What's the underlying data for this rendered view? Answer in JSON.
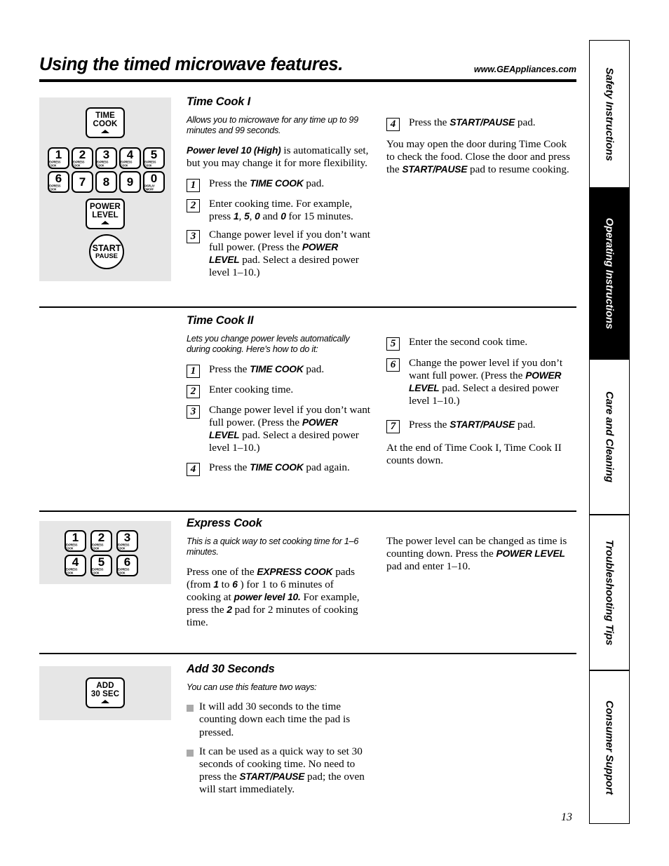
{
  "header": {
    "title": "Using the timed microwave features.",
    "url": "www.GEAppliances.com"
  },
  "page_number": "13",
  "side_tabs": [
    {
      "label": "Safety Instructions",
      "active": false
    },
    {
      "label": "Operating Instructions",
      "active": true
    },
    {
      "label": "Care and Cleaning",
      "active": false
    },
    {
      "label": "Troubleshooting Tips",
      "active": false
    },
    {
      "label": "Consumer Support",
      "active": false
    }
  ],
  "keypad_main": {
    "time_cook": {
      "line1": "TIME",
      "line2": "COOK"
    },
    "power_level": {
      "line1": "POWER",
      "line2": "LEVEL"
    },
    "start": {
      "line1": "START",
      "line2": "PAUSE"
    },
    "number_keys": [
      {
        "num": "1",
        "sub": "EXPRESS COOK"
      },
      {
        "num": "2",
        "sub": "EXPRESS COOK"
      },
      {
        "num": "3",
        "sub": "EXPRESS COOK"
      },
      {
        "num": "4",
        "sub": "EXPRESS COOK"
      },
      {
        "num": "5",
        "sub": "EXPRESS COOK"
      },
      {
        "num": "6",
        "sub": "EXPRESS COOK"
      },
      {
        "num": "7",
        "sub": ""
      },
      {
        "num": "8",
        "sub": ""
      },
      {
        "num": "9",
        "sub": ""
      },
      {
        "num": "0",
        "sub": "DISPLAY ON/OFF"
      }
    ]
  },
  "keypad_express": {
    "keys": [
      {
        "num": "1",
        "sub": "EXPRESS COOK"
      },
      {
        "num": "2",
        "sub": "EXPRESS COOK"
      },
      {
        "num": "3",
        "sub": "EXPRESS COOK"
      },
      {
        "num": "4",
        "sub": "EXPRESS COOK"
      },
      {
        "num": "5",
        "sub": "EXPRESS COOK"
      },
      {
        "num": "6",
        "sub": "EXPRESS COOK"
      }
    ]
  },
  "keypad_add30": {
    "line1": "ADD",
    "line2": "30 SEC"
  },
  "time_cook_1": {
    "title": "Time Cook I",
    "intro": "Allows you to microwave for any time up to 99 minutes and 99 seconds.",
    "note_bold": "Power level 10 (High)",
    "note_rest": " is automatically set, but you may change it for more flexibility.",
    "steps": [
      {
        "num": "1",
        "pre": "Press the ",
        "bold": "TIME COOK",
        "post": " pad."
      },
      {
        "num": "2",
        "pre": "Enter cooking time. For example, press ",
        "bold": "1",
        "mid1": ", ",
        "bold2": "5",
        "mid2": ", ",
        "bold3": "0",
        "mid3": " and ",
        "bold4": "0",
        "post": " for 15 minutes."
      },
      {
        "num": "3",
        "pre": "Change power level if you don’t want full power. (Press the ",
        "bold": "POWER LEVEL",
        "post": " pad. Select a desired power level 1–10.)"
      }
    ],
    "right_step": {
      "num": "4",
      "pre": "Press the ",
      "bold": "START/PAUSE",
      "post": " pad."
    },
    "right_p1": "You may open the door during Time Cook to check the food. Close the door and press the ",
    "right_p1_bold": "START/PAUSE",
    "right_p1_end": " pad to resume cooking."
  },
  "time_cook_2": {
    "title": "Time Cook II",
    "intro": "Lets you change power levels automatically during cooking. Here’s how to do it:",
    "steps": [
      {
        "num": "1",
        "pre": "Press the ",
        "bold": "TIME COOK",
        "post": " pad."
      },
      {
        "num": "2",
        "pre": "Enter cooking time.",
        "bold": "",
        "post": ""
      },
      {
        "num": "3",
        "pre": "Change power level if you don’t want full power. (Press the ",
        "bold": "POWER LEVEL",
        "post": " pad. Select a desired power level 1–10.)"
      },
      {
        "num": "4",
        "pre": "Press the ",
        "bold": "TIME COOK",
        "post": " pad again."
      }
    ],
    "right_steps": [
      {
        "num": "5",
        "pre": "Enter the second cook time.",
        "bold": "",
        "post": ""
      },
      {
        "num": "6",
        "pre": "Change the power level if you don’t want full power. (Press the ",
        "bold": "POWER LEVEL",
        "post": " pad. Select a desired power level 1–10.)"
      },
      {
        "num": "7",
        "pre": "Press the ",
        "bold": "START/PAUSE",
        "post": " pad."
      }
    ],
    "right_p1": "At the end of Time Cook I, Time Cook II counts down."
  },
  "express_cook": {
    "title": "Express Cook",
    "intro": "This is a quick way to set cooking time for 1–6 minutes.",
    "para_1": "Press one of the ",
    "para_bold_1": "EXPRESS COOK",
    "para_2": " pads (from ",
    "para_bold_2": "1",
    "para_3": " to ",
    "para_bold_3": "6",
    "para_4": " ) for 1 to 6 minutes of cooking at ",
    "para_bold_4": "power level 10.",
    "para_5": "  For example, press the ",
    "para_bold_5": "2",
    "para_6": " pad for 2 minutes of cooking time.",
    "right_p1": "The power level can be changed as time is counting down. Press the ",
    "right_p1_bold": "POWER LEVEL",
    "right_p1_end": " pad and enter 1–10."
  },
  "add_30_seconds": {
    "title": "Add 30 Seconds",
    "intro": "You can use this feature two ways:",
    "bullets": [
      {
        "pre": "It will add 30 seconds to the time counting down each time the pad is pressed.",
        "bold": "",
        "post": ""
      },
      {
        "pre": "It can be used as a quick way to set 30 seconds of cooking time. No need to press the ",
        "bold": "START/PAUSE",
        "post": " pad; the oven will start immediately."
      }
    ]
  }
}
